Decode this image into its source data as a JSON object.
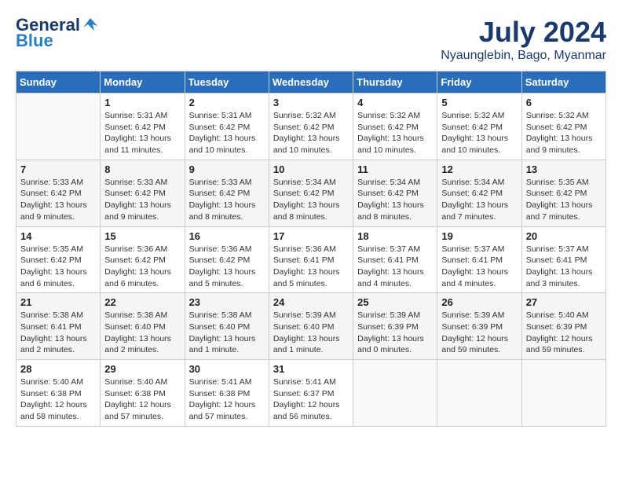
{
  "logo": {
    "line1": "General",
    "line2": "Blue"
  },
  "title": "July 2024",
  "subtitle": "Nyaunglebin, Bago, Myanmar",
  "days_header": [
    "Sunday",
    "Monday",
    "Tuesday",
    "Wednesday",
    "Thursday",
    "Friday",
    "Saturday"
  ],
  "weeks": [
    [
      {
        "day": "",
        "info": ""
      },
      {
        "day": "1",
        "info": "Sunrise: 5:31 AM\nSunset: 6:42 PM\nDaylight: 13 hours\nand 11 minutes."
      },
      {
        "day": "2",
        "info": "Sunrise: 5:31 AM\nSunset: 6:42 PM\nDaylight: 13 hours\nand 10 minutes."
      },
      {
        "day": "3",
        "info": "Sunrise: 5:32 AM\nSunset: 6:42 PM\nDaylight: 13 hours\nand 10 minutes."
      },
      {
        "day": "4",
        "info": "Sunrise: 5:32 AM\nSunset: 6:42 PM\nDaylight: 13 hours\nand 10 minutes."
      },
      {
        "day": "5",
        "info": "Sunrise: 5:32 AM\nSunset: 6:42 PM\nDaylight: 13 hours\nand 10 minutes."
      },
      {
        "day": "6",
        "info": "Sunrise: 5:32 AM\nSunset: 6:42 PM\nDaylight: 13 hours\nand 9 minutes."
      }
    ],
    [
      {
        "day": "7",
        "info": "Sunrise: 5:33 AM\nSunset: 6:42 PM\nDaylight: 13 hours\nand 9 minutes."
      },
      {
        "day": "8",
        "info": "Sunrise: 5:33 AM\nSunset: 6:42 PM\nDaylight: 13 hours\nand 9 minutes."
      },
      {
        "day": "9",
        "info": "Sunrise: 5:33 AM\nSunset: 6:42 PM\nDaylight: 13 hours\nand 8 minutes."
      },
      {
        "day": "10",
        "info": "Sunrise: 5:34 AM\nSunset: 6:42 PM\nDaylight: 13 hours\nand 8 minutes."
      },
      {
        "day": "11",
        "info": "Sunrise: 5:34 AM\nSunset: 6:42 PM\nDaylight: 13 hours\nand 8 minutes."
      },
      {
        "day": "12",
        "info": "Sunrise: 5:34 AM\nSunset: 6:42 PM\nDaylight: 13 hours\nand 7 minutes."
      },
      {
        "day": "13",
        "info": "Sunrise: 5:35 AM\nSunset: 6:42 PM\nDaylight: 13 hours\nand 7 minutes."
      }
    ],
    [
      {
        "day": "14",
        "info": "Sunrise: 5:35 AM\nSunset: 6:42 PM\nDaylight: 13 hours\nand 6 minutes."
      },
      {
        "day": "15",
        "info": "Sunrise: 5:36 AM\nSunset: 6:42 PM\nDaylight: 13 hours\nand 6 minutes."
      },
      {
        "day": "16",
        "info": "Sunrise: 5:36 AM\nSunset: 6:42 PM\nDaylight: 13 hours\nand 5 minutes."
      },
      {
        "day": "17",
        "info": "Sunrise: 5:36 AM\nSunset: 6:41 PM\nDaylight: 13 hours\nand 5 minutes."
      },
      {
        "day": "18",
        "info": "Sunrise: 5:37 AM\nSunset: 6:41 PM\nDaylight: 13 hours\nand 4 minutes."
      },
      {
        "day": "19",
        "info": "Sunrise: 5:37 AM\nSunset: 6:41 PM\nDaylight: 13 hours\nand 4 minutes."
      },
      {
        "day": "20",
        "info": "Sunrise: 5:37 AM\nSunset: 6:41 PM\nDaylight: 13 hours\nand 3 minutes."
      }
    ],
    [
      {
        "day": "21",
        "info": "Sunrise: 5:38 AM\nSunset: 6:41 PM\nDaylight: 13 hours\nand 2 minutes."
      },
      {
        "day": "22",
        "info": "Sunrise: 5:38 AM\nSunset: 6:40 PM\nDaylight: 13 hours\nand 2 minutes."
      },
      {
        "day": "23",
        "info": "Sunrise: 5:38 AM\nSunset: 6:40 PM\nDaylight: 13 hours\nand 1 minute."
      },
      {
        "day": "24",
        "info": "Sunrise: 5:39 AM\nSunset: 6:40 PM\nDaylight: 13 hours\nand 1 minute."
      },
      {
        "day": "25",
        "info": "Sunrise: 5:39 AM\nSunset: 6:39 PM\nDaylight: 13 hours\nand 0 minutes."
      },
      {
        "day": "26",
        "info": "Sunrise: 5:39 AM\nSunset: 6:39 PM\nDaylight: 12 hours\nand 59 minutes."
      },
      {
        "day": "27",
        "info": "Sunrise: 5:40 AM\nSunset: 6:39 PM\nDaylight: 12 hours\nand 59 minutes."
      }
    ],
    [
      {
        "day": "28",
        "info": "Sunrise: 5:40 AM\nSunset: 6:38 PM\nDaylight: 12 hours\nand 58 minutes."
      },
      {
        "day": "29",
        "info": "Sunrise: 5:40 AM\nSunset: 6:38 PM\nDaylight: 12 hours\nand 57 minutes."
      },
      {
        "day": "30",
        "info": "Sunrise: 5:41 AM\nSunset: 6:38 PM\nDaylight: 12 hours\nand 57 minutes."
      },
      {
        "day": "31",
        "info": "Sunrise: 5:41 AM\nSunset: 6:37 PM\nDaylight: 12 hours\nand 56 minutes."
      },
      {
        "day": "",
        "info": ""
      },
      {
        "day": "",
        "info": ""
      },
      {
        "day": "",
        "info": ""
      }
    ]
  ]
}
